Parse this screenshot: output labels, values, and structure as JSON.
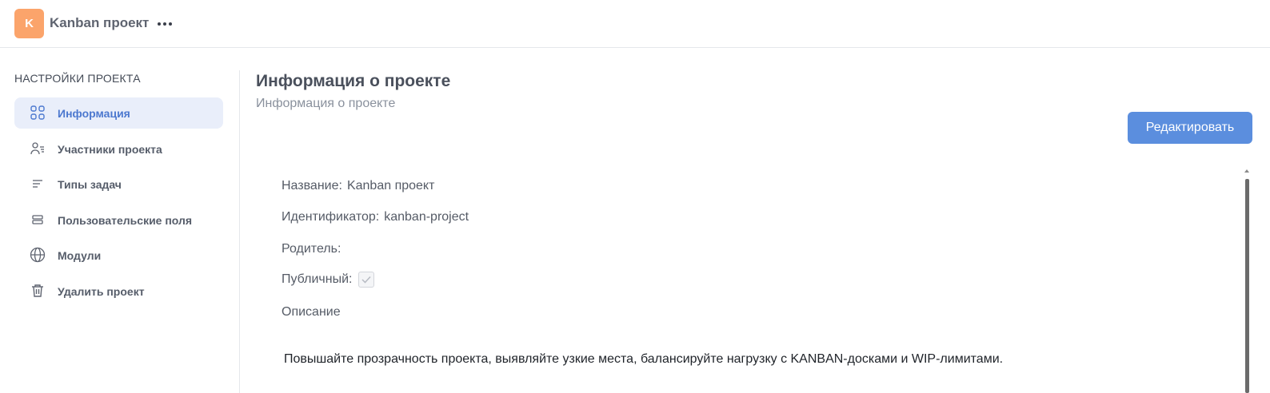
{
  "header": {
    "avatar_letter": "K",
    "project_name": "Kanban проект",
    "more_icon": "more-horizontal-icon",
    "avatar_color": "#fba46b"
  },
  "sidebar": {
    "title": "НАСТРОЙКИ ПРОЕКТА",
    "items": [
      {
        "label": "Информация",
        "icon": "grid-icon",
        "active": true
      },
      {
        "label": "Участники проекта",
        "icon": "members-icon",
        "active": false
      },
      {
        "label": "Типы задач",
        "icon": "list-icon",
        "active": false
      },
      {
        "label": "Пользовательские поля",
        "icon": "fields-icon",
        "active": false
      },
      {
        "label": "Модули",
        "icon": "globe-icon",
        "active": false
      },
      {
        "label": "Удалить проект",
        "icon": "trash-icon",
        "active": false
      }
    ]
  },
  "main": {
    "title": "Информация о проекте",
    "subtitle": "Информация о проекте",
    "edit_label": "Редактировать",
    "fields": {
      "name_label": "Название:",
      "name_value": "Kanban проект",
      "identifier_label": "Идентификатор:",
      "identifier_value": "kanban-project",
      "parent_label": "Родитель:",
      "parent_value": "",
      "public_label": "Публичный:",
      "public_checked": true,
      "description_label": "Описание"
    },
    "description_text": "Повышайте прозрачность проекта, выявляйте узкие места, балансируйте нагрузку с KANBAN-досками и WIP-лимитами."
  },
  "colors": {
    "accent": "#5b8ede",
    "active_nav_bg": "#e9eefa",
    "active_nav_text": "#4c78cf"
  }
}
